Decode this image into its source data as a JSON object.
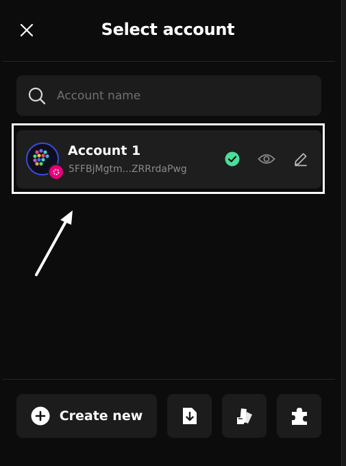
{
  "header": {
    "title": "Select account"
  },
  "search": {
    "placeholder": "Account name"
  },
  "accounts": [
    {
      "name": "Account 1",
      "address": "5FFBjMgtm...ZRRrdaPwg",
      "selected": true
    }
  ],
  "footer": {
    "create_label": "Create new"
  },
  "colors": {
    "background": "#0c0c0c",
    "surface": "#1c1c1c",
    "check": "#4ade9b",
    "polkadot_pink": "#e6007a",
    "avatar_ring": "#3b4bd8"
  },
  "icons": [
    "close-icon",
    "search-icon",
    "check-circle-icon",
    "eye-icon",
    "pencil-icon",
    "plus-circle-icon",
    "import-icon",
    "swatch-icon",
    "puzzle-icon"
  ]
}
